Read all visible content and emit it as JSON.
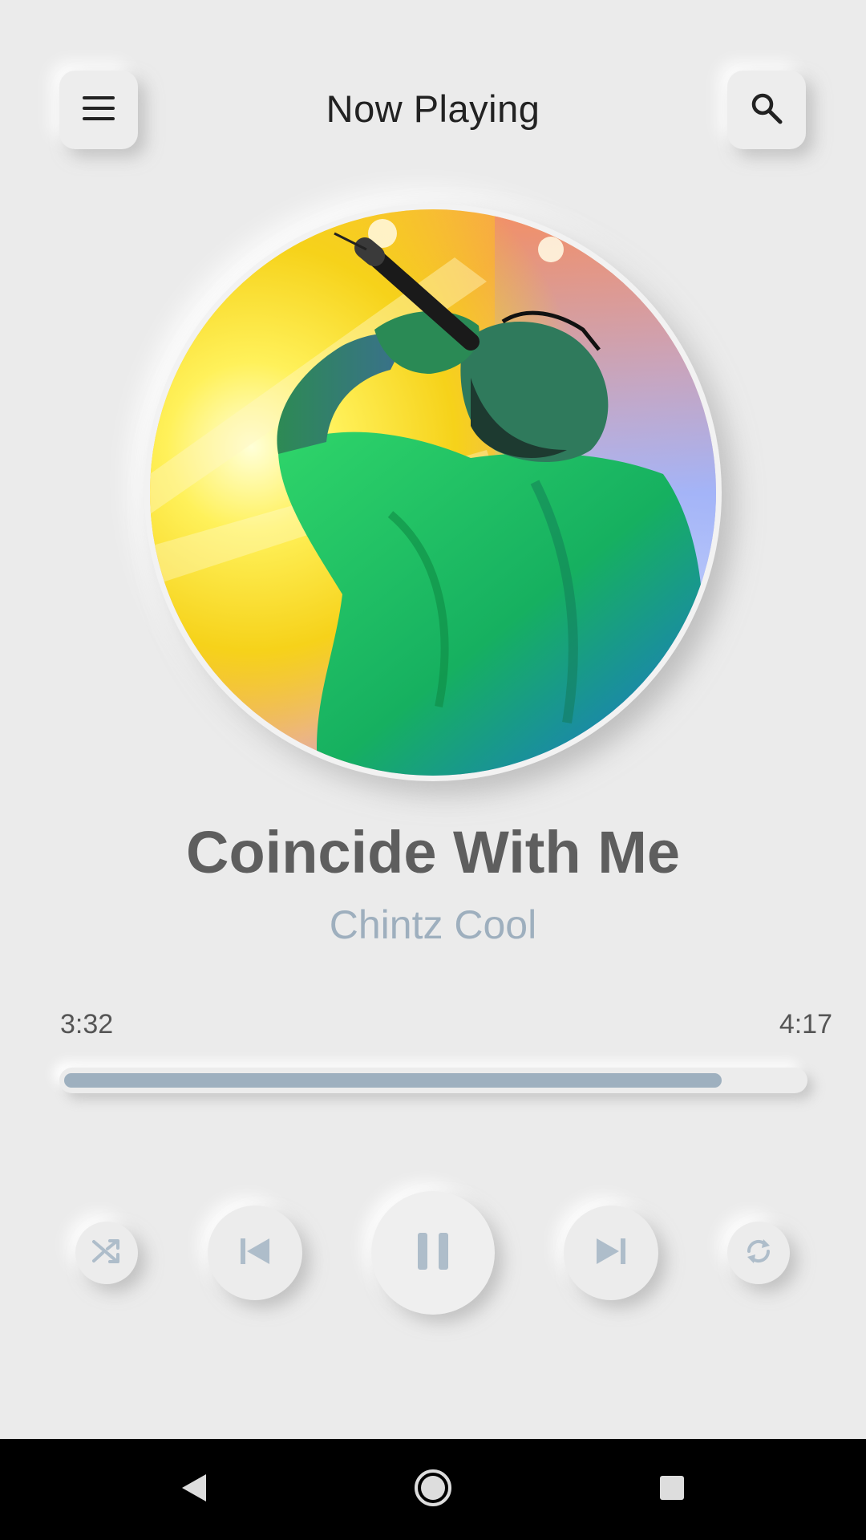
{
  "header": {
    "title": "Now Playing",
    "menu_icon": "hamburger-menu-icon",
    "search_icon": "search-icon"
  },
  "track": {
    "title": "Coincide With Me",
    "artist": "Chintz Cool",
    "elapsed": "3:32",
    "duration": "4:17",
    "progress": 0.89,
    "artwork": "singer-with-microphone-under-stage-lights"
  },
  "controls": {
    "shuffle_icon": "shuffle-icon",
    "previous_icon": "skip-previous-icon",
    "play_state_icon": "pause-icon",
    "next_icon": "skip-next-icon",
    "repeat_icon": "repeat-icon"
  },
  "colors": {
    "background": "#ebebeb",
    "accent": "#9eb0bf",
    "title": "#5e5e5e",
    "icon": "#aebdca"
  },
  "system_nav": {
    "back_icon": "back-triangle-icon",
    "home_icon": "home-circle-icon",
    "recents_icon": "recents-square-icon"
  }
}
